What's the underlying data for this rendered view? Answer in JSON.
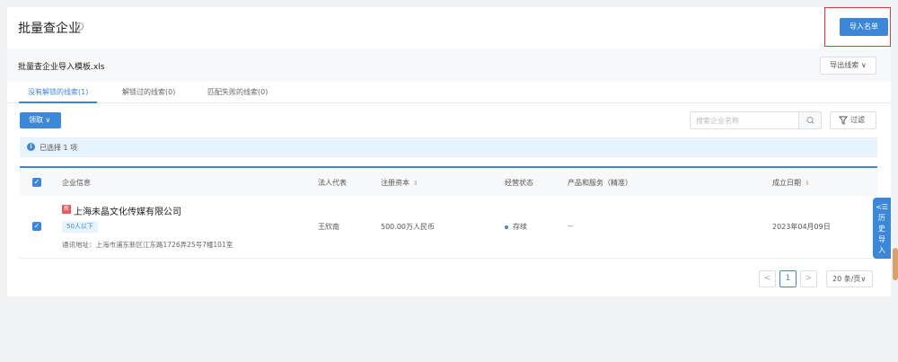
{
  "header": {
    "title": "批量查企业",
    "info_icon": "ⓘ",
    "import_button": "导入名单"
  },
  "file_bar": {
    "file_name": "批量查企业导入模板.xls",
    "export_button": "导出线索 ∨"
  },
  "tabs": [
    {
      "label": "没有解锁的线索(1)",
      "active": true
    },
    {
      "label": "解锁过的线索(0)",
      "active": false
    },
    {
      "label": "匹配失败的线索(0)",
      "active": false
    }
  ],
  "toolbar": {
    "claim_button": "领取 ∨",
    "search_placeholder": "搜索企业名称",
    "filter_button": "过滤"
  },
  "selection": {
    "icon": "i",
    "text": "已选择 1 项"
  },
  "table": {
    "headers": {
      "company_info": "企业信息",
      "legal_rep": "法人代表",
      "capital": "注册资本",
      "status": "经营状态",
      "products": "产品和服务（精准）",
      "founded": "成立日期"
    },
    "sort_icon": "⇕",
    "check_mark": "✓",
    "rows": [
      {
        "badge": "新",
        "company_name": "上海未晶文化传媒有限公司",
        "scale_tag": "50人以下",
        "address": "通讯地址：上海市浦东新区江东路1726弄25号7幢101室",
        "legal_rep": "王欣南",
        "capital": "500.00万人民币",
        "status": "存续",
        "products": "--",
        "founded": "2023年04月09日"
      }
    ]
  },
  "pagination": {
    "prev": "<",
    "current_page": "1",
    "next": ">",
    "page_size": "20 条/页∨"
  },
  "history_tab": {
    "icon": "<☰",
    "chars": [
      "历",
      "史",
      "导",
      "入"
    ]
  },
  "colors": {
    "primary": "#3d87d8",
    "highlight_border": "#e03b3b",
    "new_badge": "#e85a5a"
  }
}
